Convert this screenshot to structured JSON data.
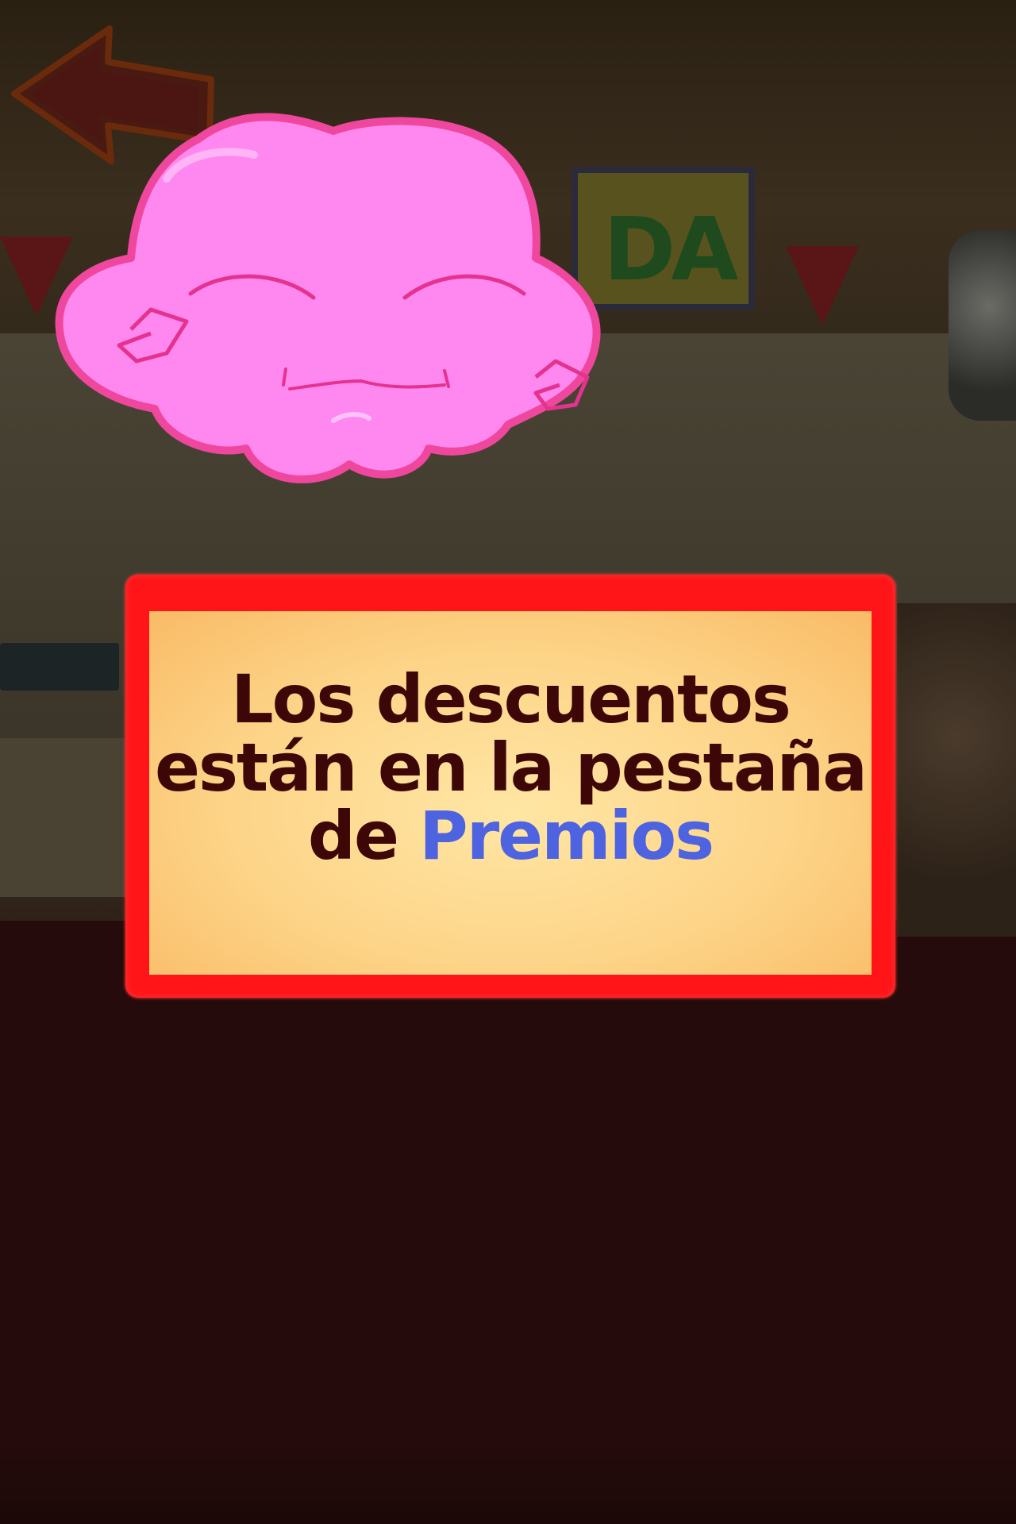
{
  "message": {
    "line1": "Los descuentos",
    "line2": "están en la pestaña",
    "line3_prefix": "de",
    "line3_highlight": "Premios"
  },
  "background_sign": {
    "text": "DA"
  },
  "colors": {
    "frame": "#ff1418",
    "panel": "#fdd488",
    "text": "#3e0707",
    "highlight": "#4d63e0",
    "character": "#ff88f0",
    "character_outline": "#f0479e"
  },
  "icons": {
    "back_arrow": "arrow-left-icon",
    "character": "pink-blob-character"
  }
}
